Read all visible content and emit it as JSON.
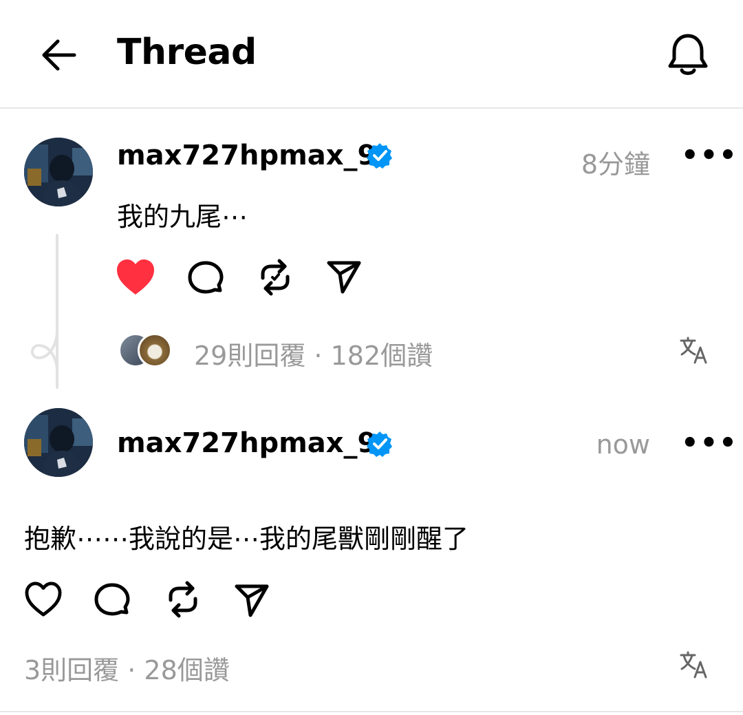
{
  "header": {
    "title": "Thread",
    "back_icon": "arrow-left-icon",
    "notification_icon": "bell-icon"
  },
  "posts": [
    {
      "username": "max727hpmax_9",
      "verified": true,
      "timestamp": "8分鐘",
      "more_label": "•••",
      "text": "我的九尾⋯",
      "liked": true,
      "replies_likes": "29則回覆 · 182個讚"
    },
    {
      "username": "max727hpmax_9",
      "verified": true,
      "timestamp": "now",
      "more_label": "•••",
      "text": "抱歉⋯⋯我說的是⋯我的尾獸剛剛醒了",
      "liked": false,
      "replies_likes": "3則回覆 · 28個讚"
    }
  ],
  "colors": {
    "like_red": "#ff3040",
    "verified_blue": "#0095f6",
    "muted_gray": "#999999"
  },
  "icons": [
    "heart-icon",
    "comment-icon",
    "repost-icon",
    "share-icon",
    "translate-icon",
    "verified-badge-icon",
    "more-icon"
  ]
}
